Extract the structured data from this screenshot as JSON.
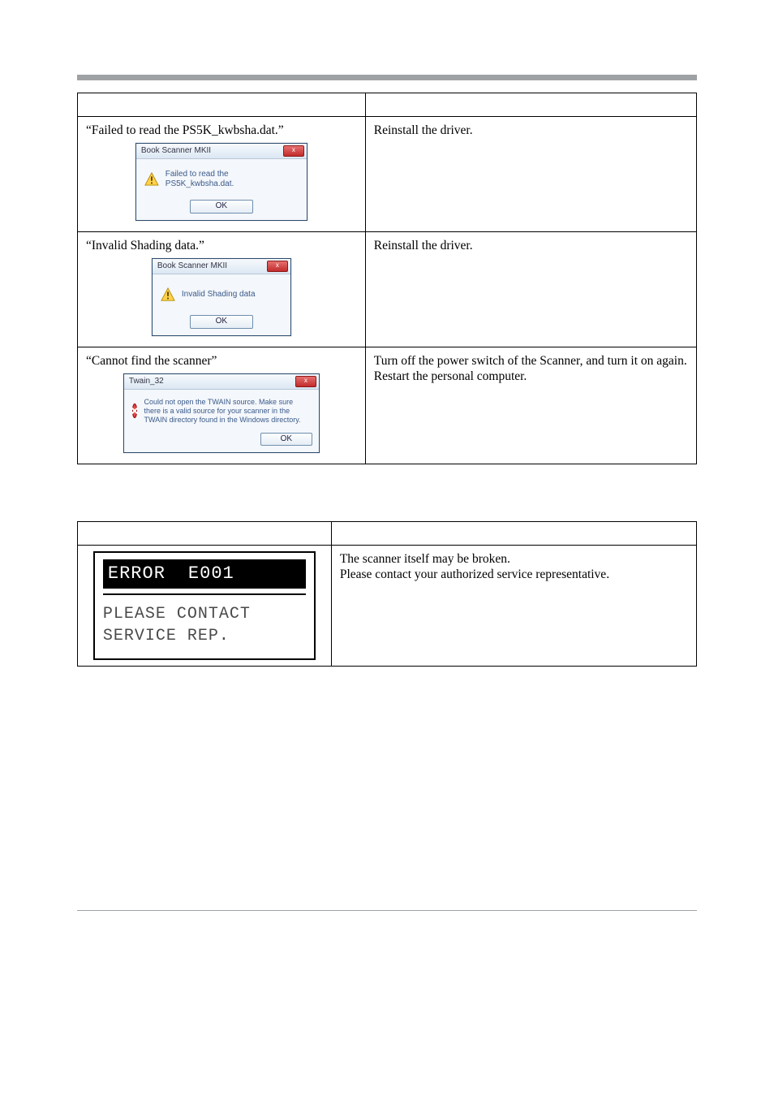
{
  "table1": {
    "headers": [
      "",
      ""
    ],
    "rows": [
      {
        "quote": "“Failed to read the PS5K_kwbsha.dat.”",
        "dialog": {
          "title": "Book Scanner MKII",
          "body": "Failed to read the PS5K_kwbsha.dat.",
          "ok": "OK",
          "icon": "warn"
        },
        "solution": "Reinstall the driver."
      },
      {
        "quote": "“Invalid Shading data.”",
        "dialog": {
          "title": "Book Scanner MKII",
          "body": "Invalid Shading data",
          "ok": "OK",
          "icon": "warn"
        },
        "solution": "Reinstall the driver."
      },
      {
        "quote": "“Cannot find the scanner”",
        "dialog": {
          "title": "Twain_32",
          "body": "Could not open the TWAIN source. Make sure there is a valid source for your scanner in the TWAIN directory found in the Windows directory.",
          "ok": "OK",
          "icon": "error"
        },
        "solution": "Turn off the power switch of the Scanner, and turn it on again. Restart the personal computer."
      }
    ]
  },
  "table2": {
    "headers": [
      "",
      ""
    ],
    "rows": [
      {
        "lcd": {
          "top1": "ERROR",
          "top2": "E001",
          "line1": "PLEASE CONTACT",
          "line2": "SERVICE REP."
        },
        "solution1": "The scanner itself may be broken.",
        "solution2": "Please contact your authorized service representative."
      }
    ]
  }
}
